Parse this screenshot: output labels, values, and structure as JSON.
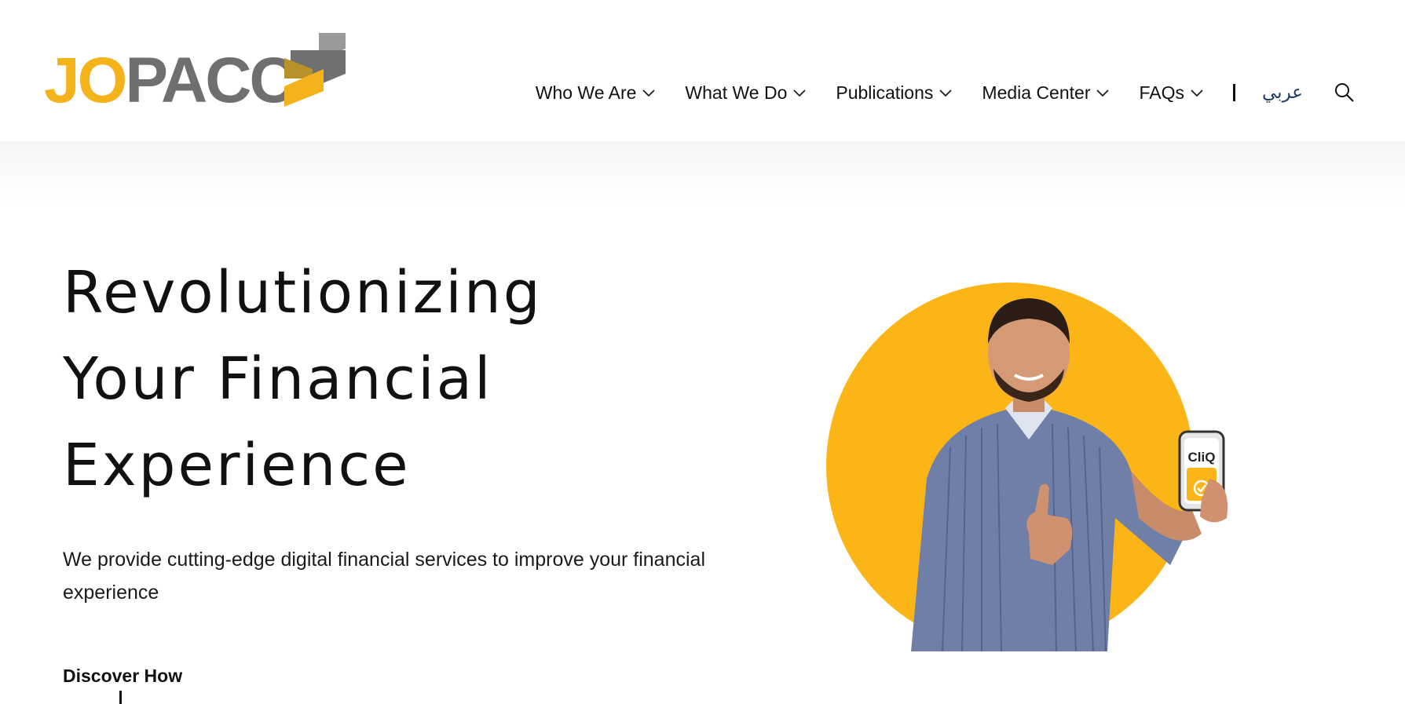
{
  "brand": {
    "logo_jo": "JO",
    "logo_pacc": "PACC",
    "colors": {
      "yellow": "#f4b31b",
      "gray": "#6f6f6f",
      "dark_gold": "#b8912a"
    }
  },
  "nav": {
    "items": [
      {
        "label": "Who We Are",
        "icon": "chevron-down-icon"
      },
      {
        "label": "What We Do",
        "icon": "chevron-down-icon"
      },
      {
        "label": "Publications",
        "icon": "chevron-down-icon"
      },
      {
        "label": "Media Center",
        "icon": "chevron-down-icon"
      },
      {
        "label": "FAQs",
        "icon": "chevron-down-icon"
      }
    ],
    "language": "عربي",
    "search_icon": "search-icon"
  },
  "hero": {
    "title_lines": [
      "Revolutionizing",
      "Your Financial",
      "Experience"
    ],
    "subtitle": "We provide cutting-edge digital financial services to improve your financial experience",
    "cta": "Discover How",
    "image": {
      "phone_brand": "CliQ",
      "circle_color": "#fbb517"
    }
  }
}
